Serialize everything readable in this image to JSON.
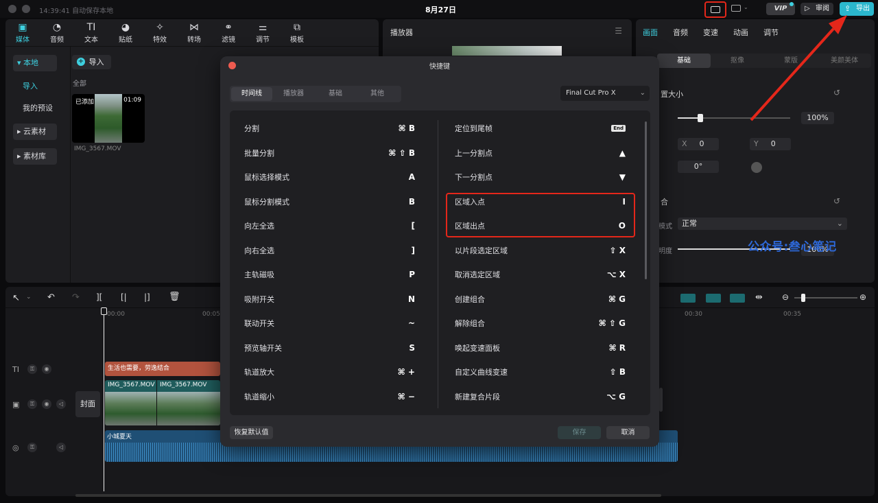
{
  "window": {
    "status": "14:39:41 自动保存本地",
    "date": "8月27日",
    "vip": "VIP",
    "review_label": "审阅",
    "export_label": "导出"
  },
  "media_tabs": [
    {
      "icon": "media-icon",
      "glyph": "▣",
      "label": "媒体"
    },
    {
      "icon": "audio-icon",
      "glyph": "◔",
      "label": "音频"
    },
    {
      "icon": "text-icon",
      "glyph": "TI",
      "label": "文本"
    },
    {
      "icon": "sticker-icon",
      "glyph": "◕",
      "label": "贴纸"
    },
    {
      "icon": "effects-icon",
      "glyph": "✧",
      "label": "特效"
    },
    {
      "icon": "transition-icon",
      "glyph": "⋈",
      "label": "转场"
    },
    {
      "icon": "filter-icon",
      "glyph": "⚭",
      "label": "滤镜"
    },
    {
      "icon": "adjust-icon",
      "glyph": "⚌",
      "label": "调节"
    },
    {
      "icon": "template-icon",
      "glyph": "⧉",
      "label": "模板"
    }
  ],
  "sidebar": {
    "local": "本地",
    "import": "导入",
    "presets": "我的预设",
    "cloud": "云素材",
    "library": "素材库"
  },
  "media": {
    "import_button": "导入",
    "filter_all": "全部",
    "added_badge": "已添加",
    "duration": "01:09",
    "filename": "IMG_3567.MOV"
  },
  "player": {
    "title": "播放器"
  },
  "inspector": {
    "tabs": [
      "画面",
      "音频",
      "变速",
      "动画",
      "调节"
    ],
    "subtabs": [
      "基础",
      "抠像",
      "蒙版",
      "美颜美体"
    ],
    "section_size": "置大小",
    "scale_value": "100%",
    "x_label": "X",
    "x_value": "0",
    "y_label": "Y",
    "y_value": "0",
    "rotation": "0°",
    "section_blend": "合",
    "mode_label": "模式",
    "mode_value": "正常",
    "opacity_label": "明度",
    "opacity_value": "100%",
    "watermark": "公众号:叁心笔记"
  },
  "timeline": {
    "ticks": [
      "00:00",
      "00:05",
      "00:30",
      "00:35"
    ],
    "text_clip": "生活也需要，劳逸结合",
    "video_clip_1": "IMG_3567.MOV",
    "video_clip_2": "IMG_3567.MOV",
    "cover_label": "封面",
    "audio_clip": "小城夏天"
  },
  "dialog": {
    "title": "快捷键",
    "tabs": [
      "时间线",
      "播放器",
      "基础",
      "其他"
    ],
    "preset": "Final Cut Pro X",
    "left_rows": [
      {
        "label": "分割",
        "keys": "⌘  B"
      },
      {
        "label": "批量分割",
        "keys": "⌘  ⇧  B"
      },
      {
        "label": "鼠标选择模式",
        "keys": "A"
      },
      {
        "label": "鼠标分割模式",
        "keys": "B"
      },
      {
        "label": "向左全选",
        "keys": "["
      },
      {
        "label": "向右全选",
        "keys": "]"
      },
      {
        "label": "主轨磁吸",
        "keys": "P"
      },
      {
        "label": "吸附开关",
        "keys": "N"
      },
      {
        "label": "联动开关",
        "keys": "~"
      },
      {
        "label": "预览轴开关",
        "keys": "S"
      },
      {
        "label": "轨道放大",
        "keys": "⌘  +"
      },
      {
        "label": "轨道缩小",
        "keys": "⌘  −"
      }
    ],
    "right_rows": [
      {
        "label": "定位到尾帧",
        "keys": "End"
      },
      {
        "label": "上一分割点",
        "keys": "▲"
      },
      {
        "label": "下一分割点",
        "keys": "▼"
      },
      {
        "label": "区域入点",
        "keys": "I"
      },
      {
        "label": "区域出点",
        "keys": "O"
      },
      {
        "label": "以片段选定区域",
        "keys": "⇧  X"
      },
      {
        "label": "取消选定区域",
        "keys": "⌥  X"
      },
      {
        "label": "创建组合",
        "keys": "⌘  G"
      },
      {
        "label": "解除组合",
        "keys": "⌘  ⇧  G"
      },
      {
        "label": "唤起变速面板",
        "keys": "⌘  R"
      },
      {
        "label": "自定义曲线变速",
        "keys": "⇧  B"
      },
      {
        "label": "新建复合片段",
        "keys": "⌥  G"
      }
    ],
    "reset_label": "恢复默认值",
    "save_label": "保存",
    "cancel_label": "取消"
  },
  "colors": {
    "accent": "#3ed0e0",
    "highlight": "#e53a2e",
    "text_clip": "#b2533e",
    "video_clip": "#1f5c5c",
    "audio_clip": "#1f4f75"
  }
}
